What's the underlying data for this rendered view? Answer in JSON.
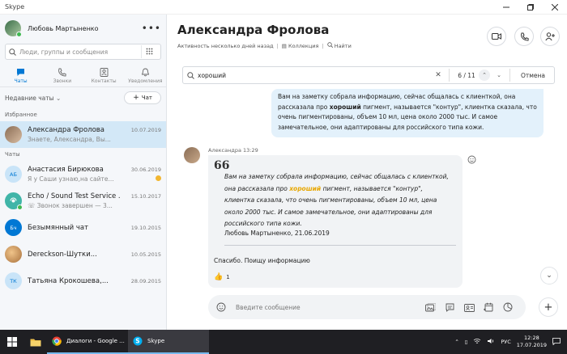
{
  "window": {
    "title": "Skype"
  },
  "sidebar": {
    "profile_name": "Любовь Мартыненко",
    "search_placeholder": "Люди, группы и сообщения",
    "tabs": [
      {
        "label": "Чаты",
        "icon": "chat-icon",
        "active": true
      },
      {
        "label": "Звонки",
        "icon": "phone-icon",
        "active": false
      },
      {
        "label": "Контакты",
        "icon": "contacts-icon",
        "active": false
      },
      {
        "label": "Уведомления",
        "icon": "bell-icon",
        "active": false
      }
    ],
    "recent_label": "Недавние чаты",
    "new_chat_label": "Чат",
    "favorites_header": "Избранное",
    "chats_header": "Чаты",
    "favorites": [
      {
        "name": "Александра Фролова",
        "date": "10.07.2019",
        "preview": "Знаете, Александра, Вы..."
      }
    ],
    "chats": [
      {
        "name": "Анастасия Бирюкова",
        "date": "30.06.2019",
        "preview": "Я у Саши узнаю,на сайте...",
        "initials": "АБ",
        "color": "#c9e4f8",
        "text_color": "#0078d4"
      },
      {
        "name": "Echo / Sound Test Service .",
        "date": "15.10.2017",
        "preview": "Звонок завершен — 3...",
        "initials": "",
        "color": "#40b5a8",
        "text_color": "#fff"
      },
      {
        "name": "Безымянный чат",
        "date": "19.10.2015",
        "preview": "",
        "initials": "Бч",
        "color": "#0078d4",
        "text_color": "#fff"
      },
      {
        "name": "Dereckson-Шутки...",
        "date": "10.05.2015",
        "preview": "",
        "initials": "",
        "color": "#d2a679",
        "text_color": "#fff"
      },
      {
        "name": "Татьяна Крокошева,...",
        "date": "28.09.2015",
        "preview": "",
        "initials": "ТК",
        "color": "#c9e4f8",
        "text_color": "#0078d4"
      }
    ]
  },
  "header": {
    "title": "Александра Фролова",
    "status": "Активность несколько дней назад",
    "collection": "Коллекция",
    "find": "Найти"
  },
  "find_bar": {
    "query": "хороший",
    "count": "6 / 11",
    "cancel": "Отмена"
  },
  "messages": {
    "outgoing": {
      "pre": "Вам на заметку собрала информацию, сейчас общалась с клиенткой, она рассказала про ",
      "highlight": "хороший",
      "post": " пигмент, называется \"контур\", клиентка сказала, что очень пигментированы,  объем 10 мл, цена около 2000 тыс. И самое замечательное, они адаптированы для российского типа кожи."
    },
    "incoming": {
      "sender": "Александра 13:29",
      "quote_mark": "66",
      "quote_pre": "Вам на заметку собрала информацию, сейчас общалась с клиенткой, она рассказала про ",
      "quote_highlight": "хороший",
      "quote_post": " пигмент, называется \"контур\", клиентка сказала, что очень пигментированы,  объем 10 мл, цена около 2000 тыс. И самое замечательное, они адаптированы для российского типа кожи.",
      "quote_author": "Любовь Мартыненко, 21.06.2019",
      "reply": "Спасибо. Поищу информацию",
      "reaction_count": "1"
    }
  },
  "compose": {
    "placeholder": "Введите сообщение"
  },
  "taskbar": {
    "apps": [
      {
        "label": "Диалоги - Google ...",
        "icon": "chrome-icon"
      },
      {
        "label": "Skype",
        "icon": "skype-icon"
      }
    ],
    "lang": "РУС",
    "time": "12:28",
    "date": "17.07.2019"
  },
  "colors": {
    "accent": "#0078d4",
    "selected": "#d3e8f7",
    "outgoing": "#e3f1fb",
    "highlight": "#e8a700"
  }
}
